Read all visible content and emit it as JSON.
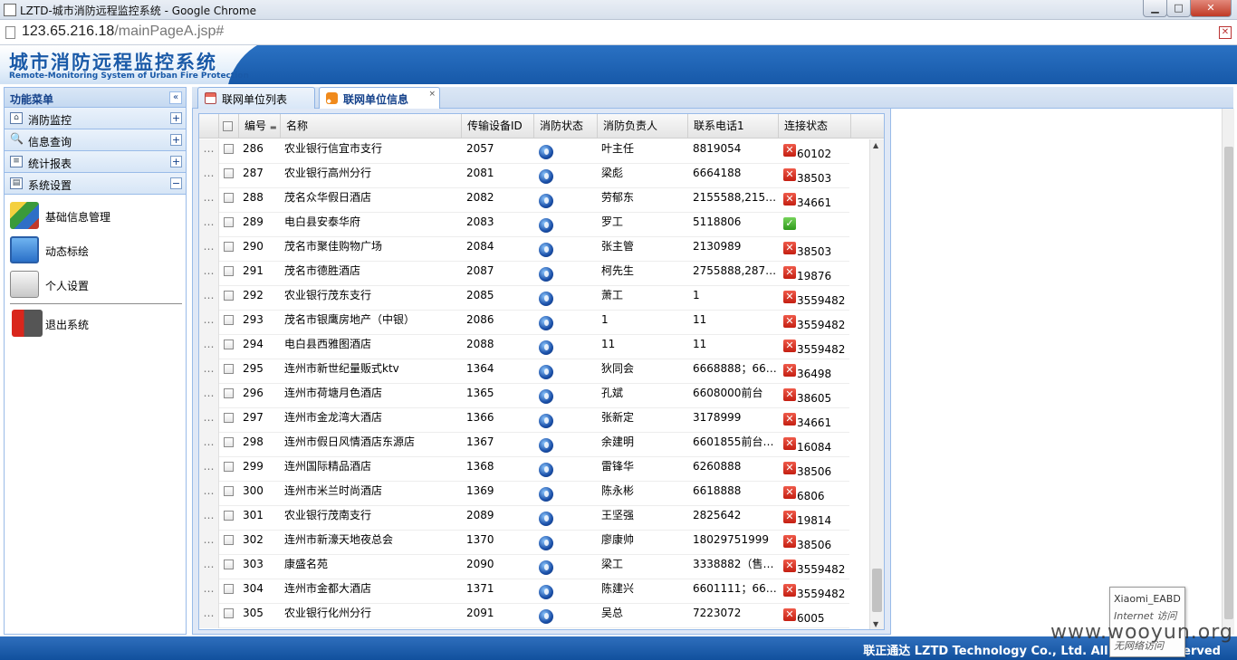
{
  "window": {
    "title": "LZTD-城市消防远程监控系统 - Google Chrome",
    "url_host": "123.65.216.18",
    "url_path": "/mainPageA.jsp#"
  },
  "app": {
    "title": "城市消防远程监控系统",
    "subtitle": "Remote-Monitoring System of Urban Fire Protection",
    "footer": "联正通达 LZTD Technology Co., Ltd. All Rights Reserved"
  },
  "sidebar": {
    "title": "功能菜单",
    "collapse": "«",
    "sections": [
      {
        "label": "消防监控",
        "toggle": "+"
      },
      {
        "label": "信息查询",
        "toggle": "+"
      },
      {
        "label": "统计报表",
        "toggle": "+"
      },
      {
        "label": "系统设置",
        "toggle": "−"
      }
    ],
    "entries": [
      {
        "label": "基础信息管理"
      },
      {
        "label": "动态标绘"
      },
      {
        "label": "个人设置"
      },
      {
        "label": "退出系统"
      }
    ]
  },
  "tabs": [
    {
      "label": "联网单位列表"
    },
    {
      "label": "联网单位信息",
      "close": "×"
    }
  ],
  "grid": {
    "headers": [
      "编号",
      "名称",
      "传输设备ID",
      "消防状态",
      "消防负责人",
      "联系电话1",
      "连接状态"
    ],
    "rows": [
      {
        "no": "286",
        "name": "农业银行信宜市支行",
        "device_id": "2057",
        "person": "叶主任",
        "phone": "8819054",
        "conn": "x",
        "code": "60102"
      },
      {
        "no": "287",
        "name": "农业银行高州分行",
        "device_id": "2081",
        "person": "梁彪",
        "phone": "6664188",
        "conn": "x",
        "code": "38503"
      },
      {
        "no": "288",
        "name": "茂名众华假日酒店",
        "device_id": "2082",
        "person": "劳郁东",
        "phone": "2155588,215…",
        "conn": "x",
        "code": "34661"
      },
      {
        "no": "289",
        "name": "电白县安泰华府",
        "device_id": "2083",
        "person": "罗工",
        "phone": "5118806",
        "conn": "ok",
        "code": ""
      },
      {
        "no": "290",
        "name": "茂名市聚佳购物广场",
        "device_id": "2084",
        "person": "张主管",
        "phone": "2130989",
        "conn": "x",
        "code": "38503"
      },
      {
        "no": "291",
        "name": "茂名市德胜酒店",
        "device_id": "2087",
        "person": "柯先生",
        "phone": "2755888,287…",
        "conn": "x",
        "code": "19876"
      },
      {
        "no": "292",
        "name": "农业银行茂东支行",
        "device_id": "2085",
        "person": "萧工",
        "phone": "1",
        "conn": "x",
        "code": "3559482"
      },
      {
        "no": "293",
        "name": "茂名市银鹰房地产（中银）",
        "device_id": "2086",
        "person": "1",
        "phone": "11",
        "conn": "x",
        "code": "3559482"
      },
      {
        "no": "294",
        "name": "电白县西雅图酒店",
        "device_id": "2088",
        "person": "11",
        "phone": "11",
        "conn": "x",
        "code": "3559482"
      },
      {
        "no": "295",
        "name": "连州市新世纪量贩式ktv",
        "device_id": "1364",
        "person": "狄同会",
        "phone": "6668888；66…",
        "conn": "x",
        "code": "36498"
      },
      {
        "no": "296",
        "name": "连州市荷塘月色酒店",
        "device_id": "1365",
        "person": "孔斌",
        "phone": "6608000前台",
        "conn": "x",
        "code": "38605"
      },
      {
        "no": "297",
        "name": "连州市金龙湾大酒店",
        "device_id": "1366",
        "person": "张新定",
        "phone": "3178999",
        "conn": "x",
        "code": "34661"
      },
      {
        "no": "298",
        "name": "连州市假日风情酒店东源店",
        "device_id": "1367",
        "person": "余建明",
        "phone": "6601855前台…",
        "conn": "x",
        "code": "16084"
      },
      {
        "no": "299",
        "name": "连州国际精品酒店",
        "device_id": "1368",
        "person": "雷锋华",
        "phone": "6260888",
        "conn": "x",
        "code": "38506"
      },
      {
        "no": "300",
        "name": "连州市米兰时尚酒店",
        "device_id": "1369",
        "person": "陈永彬",
        "phone": "6618888",
        "conn": "x",
        "code": "6806"
      },
      {
        "no": "301",
        "name": "农业银行茂南支行",
        "device_id": "2089",
        "person": "王坚强",
        "phone": "2825642",
        "conn": "x",
        "code": "19814"
      },
      {
        "no": "302",
        "name": "连州市新濠天地夜总会",
        "device_id": "1370",
        "person": "廖康帅",
        "phone": "18029751999",
        "conn": "x",
        "code": "38506"
      },
      {
        "no": "303",
        "name": "康盛名苑",
        "device_id": "2090",
        "person": "梁工",
        "phone": "3338882（售…",
        "conn": "x",
        "code": "3559482"
      },
      {
        "no": "304",
        "name": "连州市金都大酒店",
        "device_id": "1371",
        "person": "陈建兴",
        "phone": "6601111；66…",
        "conn": "x",
        "code": "3559482"
      },
      {
        "no": "305",
        "name": "农业银行化州分行",
        "device_id": "2091",
        "person": "吴总",
        "phone": "7223072",
        "conn": "x",
        "code": "6005"
      }
    ]
  },
  "tooltip": {
    "line1": "Xiaomi_EABD",
    "line2": "Internet 访问",
    "line3": "无网络访问"
  },
  "watermark": "www.wooyun.org"
}
